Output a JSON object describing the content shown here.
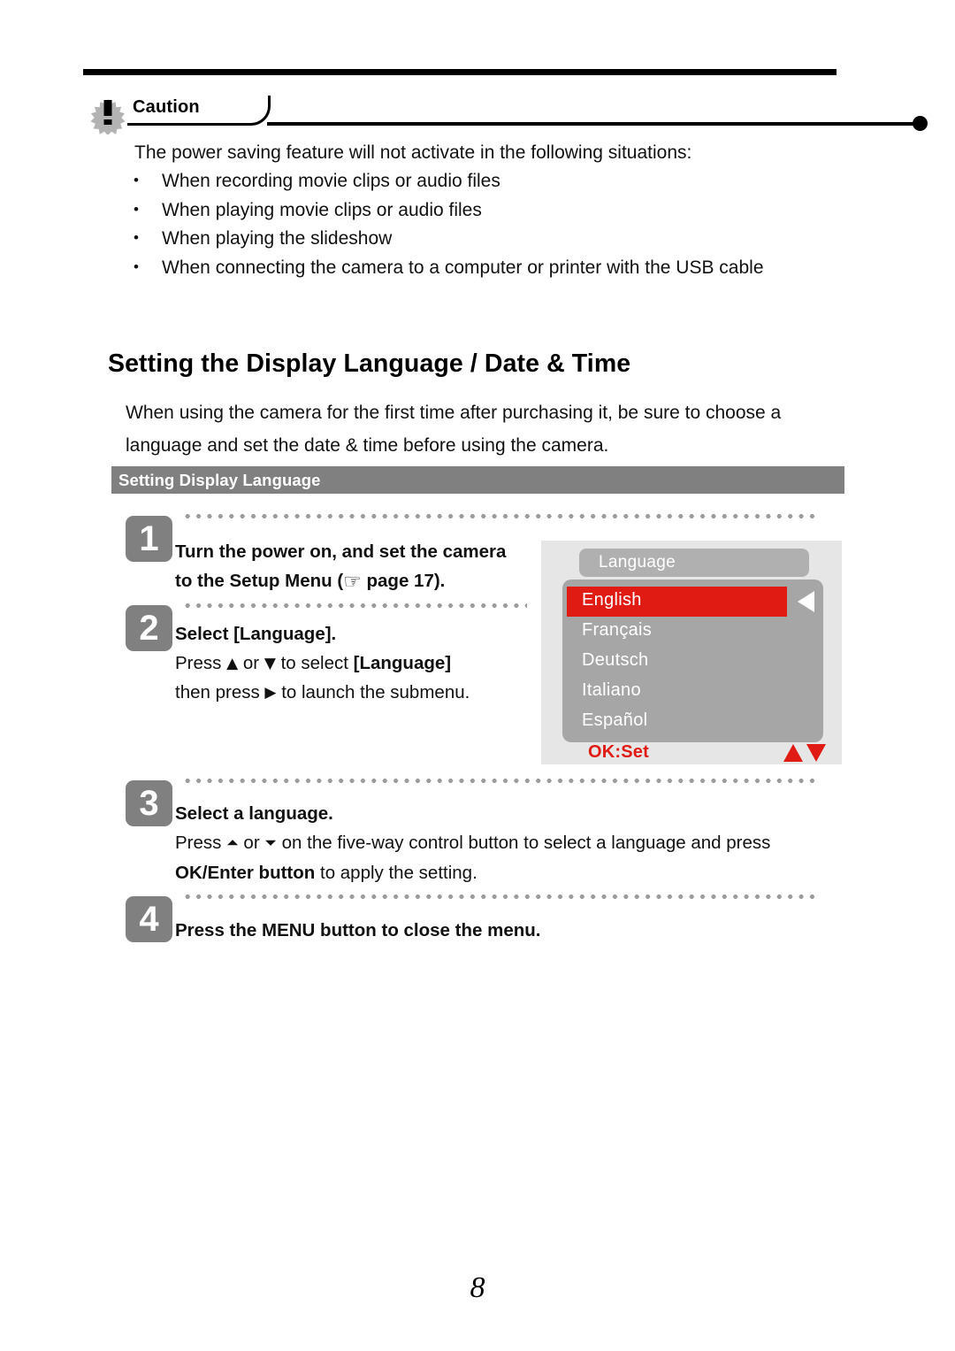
{
  "page": {
    "number": "8"
  },
  "caution": {
    "icon": "exclamation-burst-icon",
    "label": "Caution",
    "intro": "The power saving feature will not activate in the following situations:",
    "bullets": [
      "When recording movie clips or audio files",
      "When playing movie clips or audio files",
      "When playing the slideshow",
      "When connecting the camera to a computer or printer with the USB cable"
    ]
  },
  "heading": "Setting the Display Language / Date & Time",
  "intro": {
    "line1": "When using the camera for the first time after purchasing it, be sure to choose a",
    "line2": "language and set the date & time before using the camera."
  },
  "section": {
    "title": "Setting Display Language"
  },
  "steps": [
    {
      "number": "1",
      "title_line1": "Turn the power on, and set the camera",
      "title_line2_pre": "to the Setup Menu (",
      "hand_icon": "☞",
      "title_line2_post": " page 17)."
    },
    {
      "number": "2",
      "title": "Select [Language].",
      "body_line1_pre": "Press ",
      "up_arrow": "▲",
      "body_line1_mid": " or ",
      "down_arrow": "▼",
      "body_line1_post": " to select ",
      "body_line1_bold": "[Language]",
      "body_line2_pre": "then press ",
      "right_arrow": "▶",
      "body_line2_post": " to launch the submenu."
    },
    {
      "number": "3",
      "title": "Select a language.",
      "body_pre": "Press ",
      "up_arrow_box": "⏶",
      "body_mid": " or ",
      "down_arrow_box": "⏷",
      "body_post": " on the five-way control button to select a language and press",
      "body_bold": "OK/Enter button",
      "body_tail": " to apply the setting."
    },
    {
      "number": "4",
      "title": "Press the MENU button to close the menu."
    }
  ],
  "lcd": {
    "title": "Language",
    "items": [
      {
        "label": "English",
        "selected": true
      },
      {
        "label": "Français",
        "selected": false
      },
      {
        "label": "Deutsch",
        "selected": false
      },
      {
        "label": "Italiano",
        "selected": false
      },
      {
        "label": "Español",
        "selected": false
      }
    ],
    "footer_ok": "OK:Set",
    "selector_arrow": "left-triangle-icon",
    "updown_icon": "up-down-triangles-icon"
  },
  "colors": {
    "accent_red": "#e01b14",
    "bar_gray": "#808080",
    "lcd_bg": "#e6e6e6",
    "lcd_panel": "#a6a6a6",
    "lcd_title_bar": "#b0b0b0"
  }
}
